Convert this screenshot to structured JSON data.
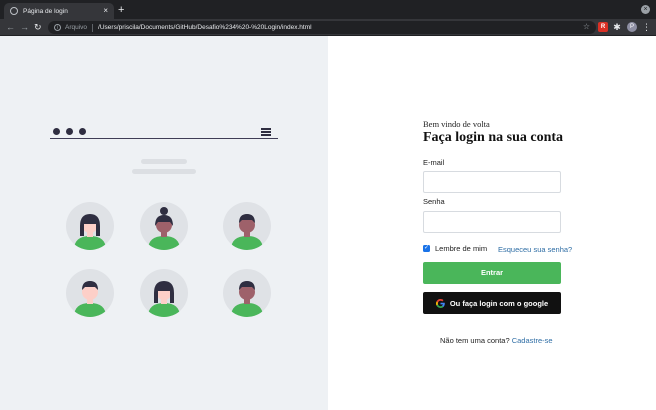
{
  "browser": {
    "tab_title": "Página de login",
    "tab_close": "×",
    "new_tab": "+",
    "window_control": "×",
    "nav": {
      "back": "←",
      "forward": "→",
      "reload": "↻"
    },
    "address": {
      "scheme_label": "Arquivo",
      "url": "/Users/priscila/Documents/GitHub/Desafio%234%20-%20Login/index.html",
      "info_icon": "i",
      "bookmark_icon": "☆"
    },
    "extensions": {
      "red_ext": "R",
      "puzzle": "✱",
      "profile": "P",
      "menu": "⋮"
    }
  },
  "illustration": {
    "avatars": [
      {
        "hair": "#2f2e41",
        "skin": "#fdcfc8",
        "shirt": "#4ab65a",
        "style": "long"
      },
      {
        "hair": "#2f2e41",
        "skin": "#9e616a",
        "shirt": "#4ab65a",
        "style": "bun"
      },
      {
        "hair": "#2f2e41",
        "skin": "#9e616a",
        "shirt": "#4ab65a",
        "style": "short"
      },
      {
        "hair": "#2f2e41",
        "skin": "#fdcfc8",
        "shirt": "#4ab65a",
        "style": "short"
      },
      {
        "hair": "#2f2e41",
        "skin": "#fdcfc8",
        "shirt": "#4ab65a",
        "style": "long"
      },
      {
        "hair": "#2f2e41",
        "skin": "#9e616a",
        "shirt": "#4ab65a",
        "style": "short"
      }
    ]
  },
  "login": {
    "welcome": "Bem vindo de volta",
    "heading": "Faça login na sua conta",
    "email_label": "E-mail",
    "email_value": "",
    "password_label": "Senha",
    "password_value": "",
    "remember_label": "Lembre de mim",
    "remember_checked": true,
    "forgot_link": "Esqueceu sua senha?",
    "submit_label": "Entrar",
    "google_label": "Ou faça login com o google",
    "signup_prompt": "Não tem uma conta?",
    "signup_link": "Cadastre-se"
  },
  "colors": {
    "accent_green": "#4ab65a",
    "link_blue": "#2f6ea5",
    "panel_bg": "#eef1f4",
    "dark_button": "#111111"
  }
}
